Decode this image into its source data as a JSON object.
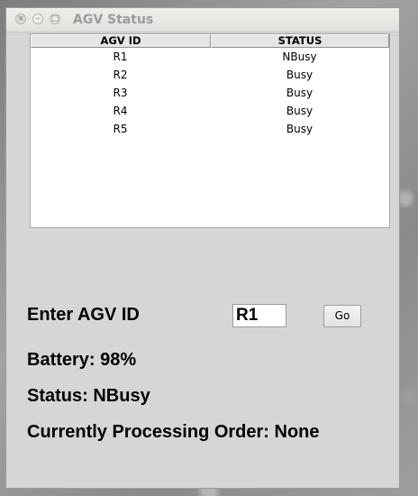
{
  "window": {
    "title": "AGV Status",
    "controls": {
      "close": "×",
      "minimize": "–",
      "maximize": "□"
    }
  },
  "table": {
    "columns": [
      "AGV ID",
      "STATUS"
    ],
    "rows": [
      {
        "id": "R1",
        "status": "NBusy"
      },
      {
        "id": "R2",
        "status": "Busy"
      },
      {
        "id": "R3",
        "status": "Busy"
      },
      {
        "id": "R4",
        "status": "Busy"
      },
      {
        "id": "R5",
        "status": "Busy"
      }
    ]
  },
  "form": {
    "label": "Enter AGV ID",
    "input_value": "R1",
    "go_label": "Go"
  },
  "info": {
    "battery": "Battery: 98%",
    "status": "Status: NBusy",
    "order": "Currently Processing Order: None"
  }
}
